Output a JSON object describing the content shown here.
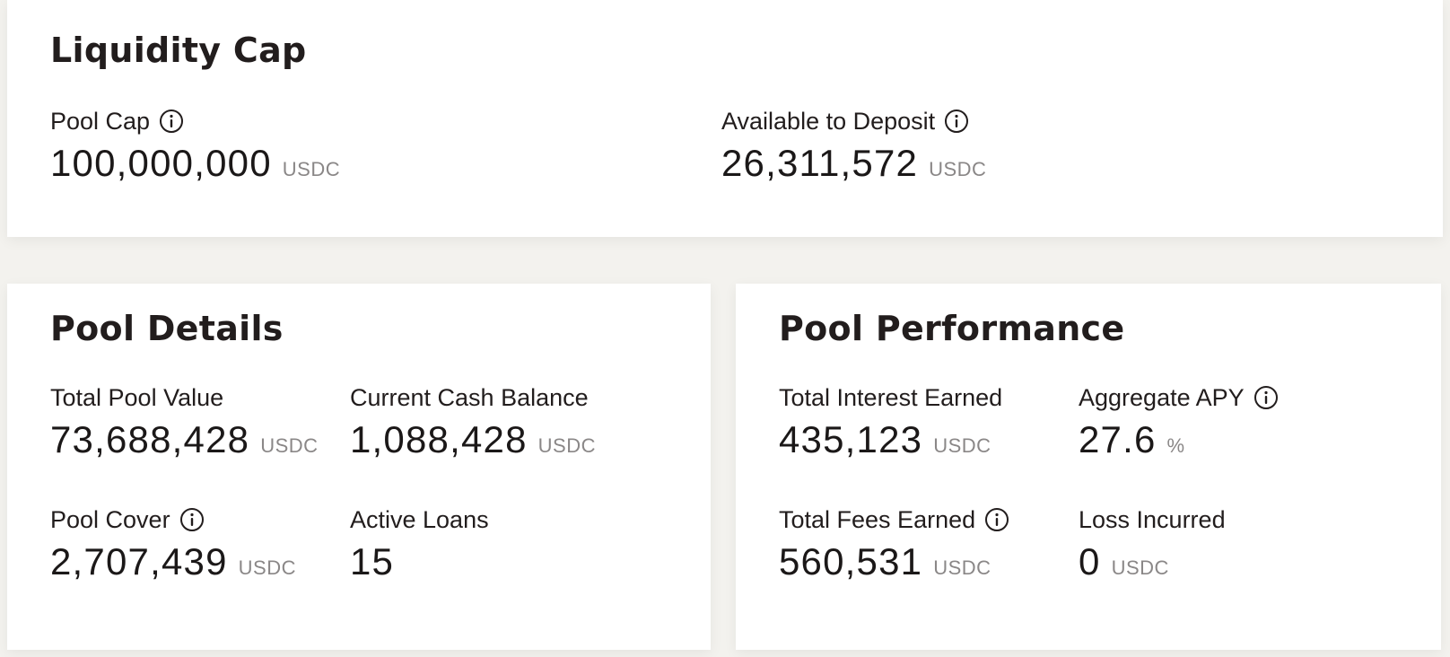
{
  "liquidity_cap": {
    "title": "Liquidity Cap",
    "pool_cap": {
      "label": "Pool Cap",
      "value": "100,000,000",
      "unit": "USDC"
    },
    "available_to_deposit": {
      "label": "Available to Deposit",
      "value": "26,311,572",
      "unit": "USDC"
    }
  },
  "pool_details": {
    "title": "Pool Details",
    "total_pool_value": {
      "label": "Total Pool Value",
      "value": "73,688,428",
      "unit": "USDC"
    },
    "current_cash_balance": {
      "label": "Current Cash Balance",
      "value": "1,088,428",
      "unit": "USDC"
    },
    "pool_cover": {
      "label": "Pool Cover",
      "value": "2,707,439",
      "unit": "USDC"
    },
    "active_loans": {
      "label": "Active Loans",
      "value": "15"
    }
  },
  "pool_performance": {
    "title": "Pool Performance",
    "total_interest_earned": {
      "label": "Total Interest Earned",
      "value": "435,123",
      "unit": "USDC"
    },
    "aggregate_apy": {
      "label": "Aggregate APY",
      "value": "27.6",
      "unit": "%"
    },
    "total_fees_earned": {
      "label": "Total Fees Earned",
      "value": "560,531",
      "unit": "USDC"
    },
    "loss_incurred": {
      "label": "Loss Incurred",
      "value": "0",
      "unit": "USDC"
    }
  },
  "icons": {
    "info": "info-circle-icon"
  },
  "colors": {
    "background": "#f3f2ee",
    "card": "#ffffff",
    "text": "#1f1c1c",
    "unit": "#8a8787"
  }
}
